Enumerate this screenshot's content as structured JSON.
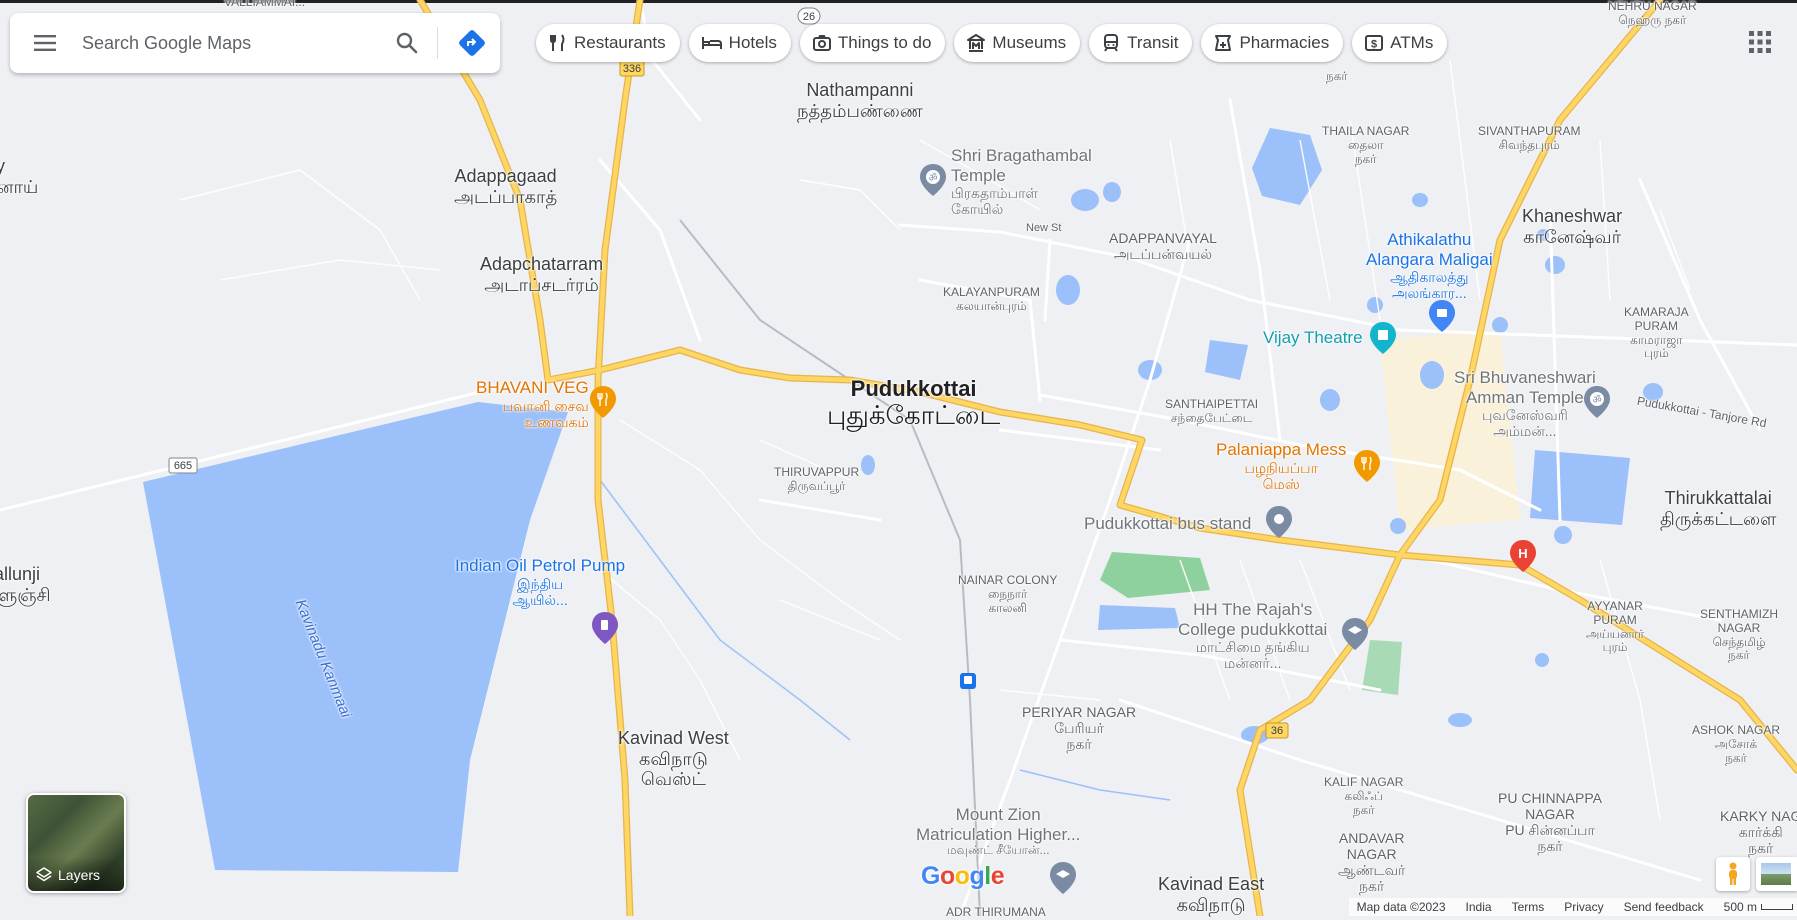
{
  "search": {
    "placeholder": "Search Google Maps"
  },
  "chips": [
    {
      "label": "Restaurants",
      "icon": "fork-knife-icon"
    },
    {
      "label": "Hotels",
      "icon": "bed-icon"
    },
    {
      "label": "Things to do",
      "icon": "camera-icon"
    },
    {
      "label": "Museums",
      "icon": "museum-icon"
    },
    {
      "label": "Transit",
      "icon": "train-icon"
    },
    {
      "label": "Pharmacies",
      "icon": "pharmacy-icon"
    },
    {
      "label": "ATMs",
      "icon": "atm-icon"
    }
  ],
  "layers_label": "Layers",
  "footer": {
    "map_data": "Map data ©2023",
    "region": "India",
    "terms": "Terms",
    "privacy": "Privacy",
    "feedback": "Send feedback",
    "scale": "500 m"
  },
  "google_logo": "Google",
  "colors": {
    "land": "#eef0f3",
    "water": "#9cc0f9",
    "highway": "#fbc02d",
    "road": "#ffffff",
    "park": "#8fd19e",
    "poi_orange": "#e37400",
    "poi_blue": "#1a73e8"
  },
  "road_shields": [
    "26",
    "336",
    "665",
    "36"
  ],
  "labels": {
    "valliammai": "VALLIAMMAI...",
    "nehru_nagar": {
      "en": "NEHRU NAGAR",
      "ta": "நெஹ்ரு நகர்"
    },
    "nathampanni": {
      "en": "Nathampanni",
      "ta": "நத்தம்பண்ணை"
    },
    "adappagaad": {
      "en": "Adappagaad",
      "ta": "அடப்பாகாத்"
    },
    "adapchatarram": {
      "en": "Adapchatarram",
      "ta": "அடாப்சடர்ரம்"
    },
    "left_edge_ta": {
      "en": "y",
      "ta": "னாய்"
    },
    "shri_bragathambal": {
      "en": "Shri Bragathambal Temple",
      "ta1": "பிரகதாம்பாள்",
      "ta2": "கோயில்"
    },
    "new_st": "New St",
    "adappanvayal": {
      "en": "ADAPPANVAYAL",
      "ta": "அடப்பன்வயல்"
    },
    "thaila_nagar": {
      "en": "THAILA NAGAR",
      "ta1": "தைலா",
      "ta2": "நகர்"
    },
    "top_nagar": "நகர்",
    "sivanthapuram": {
      "en": "SIVANTHAPURAM",
      "ta": "சிவந்தபுரம்"
    },
    "khaneshwar": {
      "en": "Khaneshwar",
      "ta": "கானேஷ்வர்"
    },
    "athikalathu": {
      "en1": "Athikalathu",
      "en2": "Alangara Maligai",
      "ta1": "ஆதிகாலத்து",
      "ta2": "அலங்கார..."
    },
    "kalayanpuram": {
      "en": "KALAYANPURAM",
      "ta": "கலயான்புரம்"
    },
    "vijay_theatre": "Vijay Theatre",
    "kamaraja_puram": {
      "en1": "KAMARAJA",
      "en2": "PURAM",
      "ta1": "காமராஜா",
      "ta2": "புரம்"
    },
    "bhavani_veg": {
      "en": "BHAVANI VEG",
      "ta1": "பவானி சைவ",
      "ta2": "உணவகம்"
    },
    "pudukkottai": {
      "en": "Pudukkottai",
      "ta": "புதுக்கோட்டை"
    },
    "santhaipettai": {
      "en": "SANTHAIPETTAI",
      "ta": "சந்தைபேட்டை"
    },
    "sri_bhuvaneshwari": {
      "en1": "Sri Bhuvaneshwari",
      "en2": "Amman Temple",
      "ta1": "புவனேஸ்வரி",
      "ta2": "அம்மன்..."
    },
    "tanjore_rd": "Pudukkottai - Tanjore Rd",
    "thiruvappur": {
      "en": "THIRUVAPPUR",
      "ta": "திருவப்பூர்"
    },
    "palaniappa_mess": {
      "en": "Palaniappa Mess",
      "ta1": "பழநியப்பா",
      "ta2": "மெஸ்"
    },
    "thirukkattalai": {
      "en": "Thirukkattalai",
      "ta": "திருக்கட்டளை"
    },
    "bus_stand": "Pudukkottai bus stand",
    "kallunji": {
      "en": "allunji",
      "ta": "ளுஞ்சி"
    },
    "indian_oil": {
      "en": "Indian Oil Petrol Pump",
      "ta1": "இந்திய",
      "ta2": "ஆயில்..."
    },
    "nainar_colony": {
      "en": "NAINAR COLONY",
      "ta1": "நைநார்",
      "ta2": "காலனி"
    },
    "hh_rajahs": {
      "en1": "HH The Rajah's",
      "en2": "College pudukkottai",
      "ta1": "மாட்சிமை தங்கிய",
      "ta2": "மன்னர்..."
    },
    "ayyanar_puram": {
      "en1": "AYYANAR",
      "en2": "PURAM",
      "ta1": "அய்யனார்",
      "ta2": "புரம்"
    },
    "senthamizh_nagar": {
      "en1": "SENTHAMIZH",
      "en2": "NAGAR",
      "ta1": "செந்தமிழ்",
      "ta2": "நகர்"
    },
    "kavinadu_kanmaai": "Kavinadu Kanmaai",
    "periyar_nagar": {
      "en": "PERIYAR NAGAR",
      "ta1": "பேரியர்",
      "ta2": "நகர்"
    },
    "kavinad_west": {
      "en": "Kavinad West",
      "ta1": "கவிநாடு",
      "ta2": "வெஸ்ட்"
    },
    "ashok_nagar": {
      "en": "ASHOK NAGAR",
      "ta1": "அசோக்",
      "ta2": "நகர்"
    },
    "kalif_nagar": {
      "en": "KALIF NAGAR",
      "ta1": "கலிஃப்",
      "ta2": "நகர்"
    },
    "pu_chinnappa": {
      "en1": "PU CHINNAPPA",
      "en2": "NAGAR",
      "ta1": "PU சின்னப்பா",
      "ta2": "நகர்"
    },
    "andavar_nagar": {
      "en1": "ANDAVAR",
      "en2": "NAGAR",
      "ta1": "ஆண்டவர்",
      "ta2": "நகர்"
    },
    "karky_nagar": {
      "en": "KARKY NAG",
      "ta1": "கார்க்கி",
      "ta2": "நகர்"
    },
    "mount_zion": {
      "en1": "Mount Zion",
      "en2": "Matriculation Higher...",
      "ta": "மவுண்ட் சீயோன்..."
    },
    "kavinad_east": {
      "en": "Kavinad East",
      "ta": "கவிநாடு"
    },
    "adr_thirumana": "ADR THIRUMANA"
  }
}
